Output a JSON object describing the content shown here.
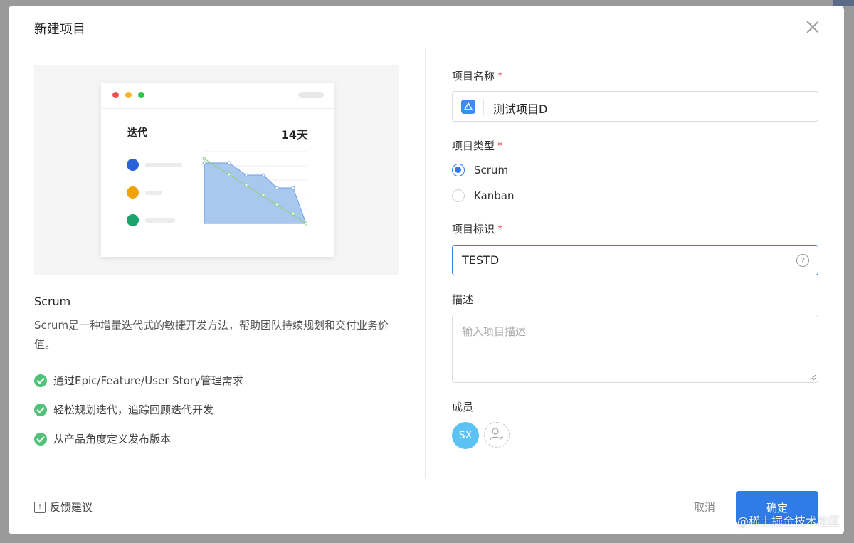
{
  "dialog": {
    "title": "新建项目"
  },
  "illustration": {
    "card_label": "迭代",
    "card_days": "14天"
  },
  "left": {
    "heading": "Scrum",
    "description": "Scrum是一种增量迭代式的敏捷开发方法，帮助团队持续规划和交付业务价值。",
    "features": [
      "通过Epic/Feature/User Story管理需求",
      "轻松规划迭代，追踪回顾迭代开发",
      "从产品角度定义发布版本"
    ]
  },
  "form": {
    "name_label": "项目名称",
    "name_value": "测试项目D",
    "type_label": "项目类型",
    "type_options": [
      "Scrum",
      "Kanban"
    ],
    "type_selected": "Scrum",
    "id_label": "项目标识",
    "id_value": "TESTD",
    "desc_label": "描述",
    "desc_placeholder": "输入项目描述",
    "members_label": "成员",
    "member_initials": "SX",
    "required_mark": "*"
  },
  "footer": {
    "feedback": "反馈建议",
    "cancel": "取消",
    "ok": "确定"
  },
  "watermark": "@稀土掘金技术社区",
  "colors": {
    "primary": "#2f7be8",
    "check_green": "#52c17a",
    "required_red": "#e5484d",
    "avatar": "#5cc1f4"
  }
}
